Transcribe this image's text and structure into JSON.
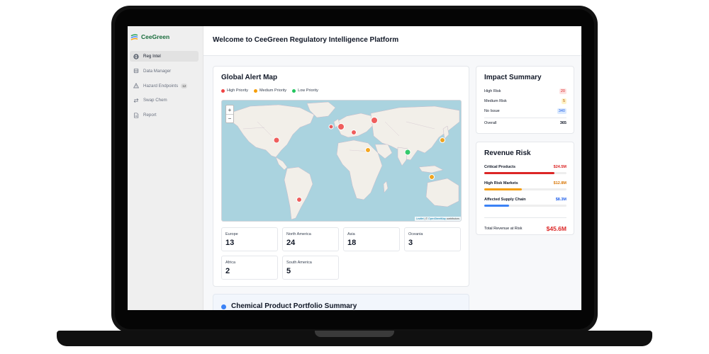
{
  "brand": {
    "name": "CeeGreen"
  },
  "sidebar": {
    "items": [
      {
        "label": "Reg Intel",
        "icon": "globe-icon",
        "active": true
      },
      {
        "label": "Data Manager",
        "icon": "database-icon",
        "active": false
      },
      {
        "label": "Hazard Endpoints",
        "icon": "warning-icon",
        "badge": "12",
        "active": false
      },
      {
        "label": "Swap Chem",
        "icon": "swap-icon",
        "active": false
      },
      {
        "label": "Report",
        "icon": "document-icon",
        "active": false
      }
    ]
  },
  "header": {
    "title": "Welcome to CeeGreen Regulatory Intelligence Platform"
  },
  "map_card": {
    "title": "Global Alert Map",
    "legend": [
      {
        "label": "High Priority",
        "color": "#ef4444"
      },
      {
        "label": "Medium Priority",
        "color": "#f59e0b"
      },
      {
        "label": "Low Priority",
        "color": "#22c55e"
      }
    ],
    "zoom_in": "+",
    "zoom_out": "−",
    "attribution": {
      "leaflet": "Leaflet",
      "sep": " | © ",
      "osm": "OpenStreetMap",
      "suffix": " contributors"
    },
    "regions": [
      {
        "name": "Europe",
        "count": "13"
      },
      {
        "name": "North America",
        "count": "24"
      },
      {
        "name": "Asia",
        "count": "18"
      },
      {
        "name": "Oceania",
        "count": "3"
      },
      {
        "name": "Africa",
        "count": "2"
      },
      {
        "name": "South America",
        "count": "5"
      }
    ]
  },
  "impact": {
    "title": "Impact Summary",
    "rows": [
      {
        "label": "High Risk",
        "value": "20",
        "tone": "red"
      },
      {
        "label": "Medium Risk",
        "value": "5",
        "tone": "yellow"
      },
      {
        "label": "No Issue",
        "value": "340",
        "tone": "blue"
      }
    ],
    "overall_label": "Overall",
    "overall_value": "365"
  },
  "revenue": {
    "title": "Revenue Risk",
    "rows": [
      {
        "label": "Critical Products",
        "value": "$24.5M",
        "color": "#dc2626",
        "fraction": 0.85
      },
      {
        "label": "High Risk Markets",
        "value": "$12.8M",
        "color": "#f59e0b",
        "fraction": 0.46
      },
      {
        "label": "Affected Supply Chain",
        "value": "$8.3M",
        "color": "#3b82f6",
        "fraction": 0.3
      }
    ],
    "total_label": "Total Revenue at Risk",
    "total_value": "$45.6M"
  },
  "portfolio": {
    "title": "Chemical Product Portfolio Summary",
    "dot_color": "#3b82f6"
  }
}
